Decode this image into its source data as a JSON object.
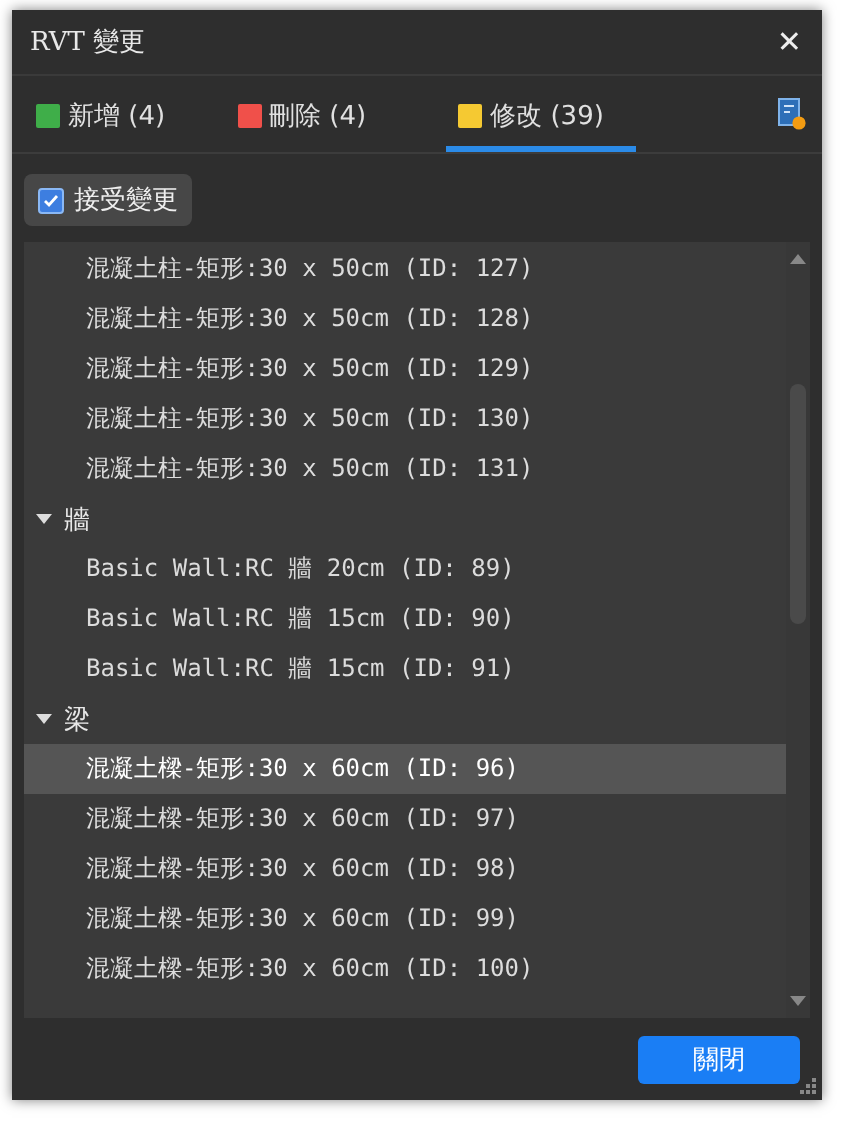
{
  "window": {
    "title": "RVT 變更",
    "close": "✕"
  },
  "tabs": [
    {
      "label": "新增 (4)",
      "color": "#3fae49",
      "selected": false
    },
    {
      "label": "刪除 (4)",
      "color": "#f0504a",
      "selected": false
    },
    {
      "label": "修改 (39)",
      "color": "#f5c932",
      "selected": true
    }
  ],
  "accept_button": {
    "label": "接受變更",
    "checked": true
  },
  "tree": [
    {
      "kind": "item",
      "label": "混凝土柱-矩形:30 x 50cm (ID: 127)",
      "selected": false
    },
    {
      "kind": "item",
      "label": "混凝土柱-矩形:30 x 50cm (ID: 128)",
      "selected": false
    },
    {
      "kind": "item",
      "label": "混凝土柱-矩形:30 x 50cm (ID: 129)",
      "selected": false
    },
    {
      "kind": "item",
      "label": "混凝土柱-矩形:30 x 50cm (ID: 130)",
      "selected": false
    },
    {
      "kind": "item",
      "label": "混凝土柱-矩形:30 x 50cm (ID: 131)",
      "selected": false
    },
    {
      "kind": "group",
      "label": "牆",
      "expanded": true,
      "children": [
        {
          "kind": "item",
          "label": "Basic Wall:RC 牆 20cm (ID: 89)",
          "selected": false
        },
        {
          "kind": "item",
          "label": "Basic Wall:RC 牆 15cm (ID: 90)",
          "selected": false
        },
        {
          "kind": "item",
          "label": "Basic Wall:RC 牆 15cm (ID: 91)",
          "selected": false
        }
      ]
    },
    {
      "kind": "group",
      "label": "梁",
      "expanded": true,
      "children": [
        {
          "kind": "item",
          "label": "混凝土樑-矩形:30 x 60cm (ID: 96)",
          "selected": true
        },
        {
          "kind": "item",
          "label": "混凝土樑-矩形:30 x 60cm (ID: 97)",
          "selected": false
        },
        {
          "kind": "item",
          "label": "混凝土樑-矩形:30 x 60cm (ID: 98)",
          "selected": false
        },
        {
          "kind": "item",
          "label": "混凝土樑-矩形:30 x 60cm (ID: 99)",
          "selected": false
        },
        {
          "kind": "item",
          "label": "混凝土樑-矩形:30 x 60cm (ID: 100)",
          "selected": false
        }
      ]
    }
  ],
  "close_button": {
    "label": "關閉"
  }
}
